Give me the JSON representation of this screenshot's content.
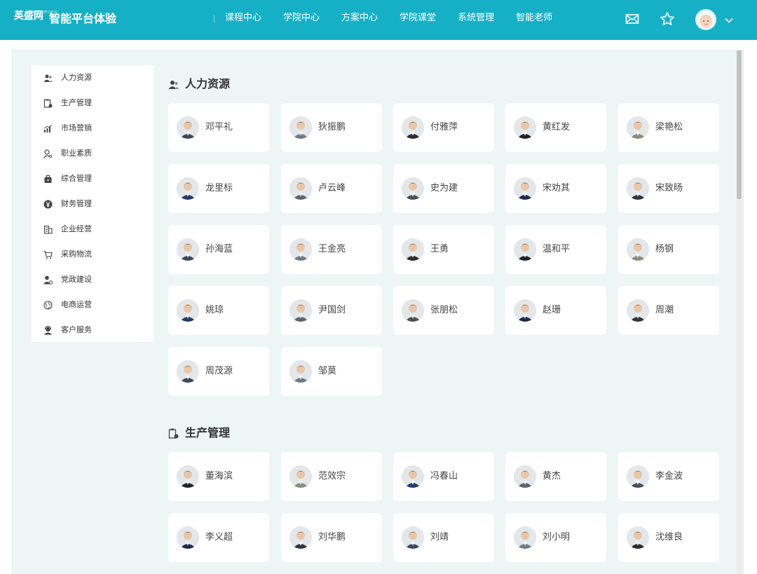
{
  "header": {
    "logo_text": "英盛网",
    "logo_subtext": "职业经理人学习平台",
    "title": "智能平台体验",
    "nav": [
      "课程中心",
      "学院中心",
      "方案中心",
      "学院课堂",
      "系统管理",
      "智能老师"
    ],
    "icons": [
      "mail-icon",
      "star-icon",
      "avatar",
      "chevron-down-icon"
    ],
    "accent_color": "#16b0c6"
  },
  "sidebar": {
    "items": [
      {
        "label": "人力资源",
        "icon": "user-group-icon"
      },
      {
        "label": "生产管理",
        "icon": "clipboard-gear-icon"
      },
      {
        "label": "市场营销",
        "icon": "bar-chart-icon"
      },
      {
        "label": "职业素质",
        "icon": "user-search-icon"
      },
      {
        "label": "综合管理",
        "icon": "briefcase-icon"
      },
      {
        "label": "财务管理",
        "icon": "yuan-coin-icon"
      },
      {
        "label": "企业经营",
        "icon": "building-icon"
      },
      {
        "label": "采购物流",
        "icon": "cart-icon"
      },
      {
        "label": "党政建设",
        "icon": "user-flag-icon"
      },
      {
        "label": "电商运营",
        "icon": "globe-icon"
      },
      {
        "label": "客户服务",
        "icon": "customer-service-icon"
      }
    ]
  },
  "sections": [
    {
      "title": "人力资源",
      "teachers": [
        "邓平礼",
        "狄振鹏",
        "付雅萍",
        "黄红发",
        "梁艳松",
        "龙里标",
        "卢云峰",
        "史为建",
        "宋劝其",
        "宋致旸",
        "孙海蓝",
        "王金亮",
        "王勇",
        "温和平",
        "杨钢",
        "姚琼",
        "尹国剑",
        "张朋松",
        "赵珊",
        "周潮",
        "周茂源",
        "邹莫"
      ]
    },
    {
      "title": "生产管理",
      "teachers": [
        "董海滨",
        "范效宗",
        "冯春山",
        "黄杰",
        "李金波",
        "李义超",
        "刘华鹏",
        "刘靖",
        "刘小明",
        "沈维良"
      ]
    }
  ]
}
